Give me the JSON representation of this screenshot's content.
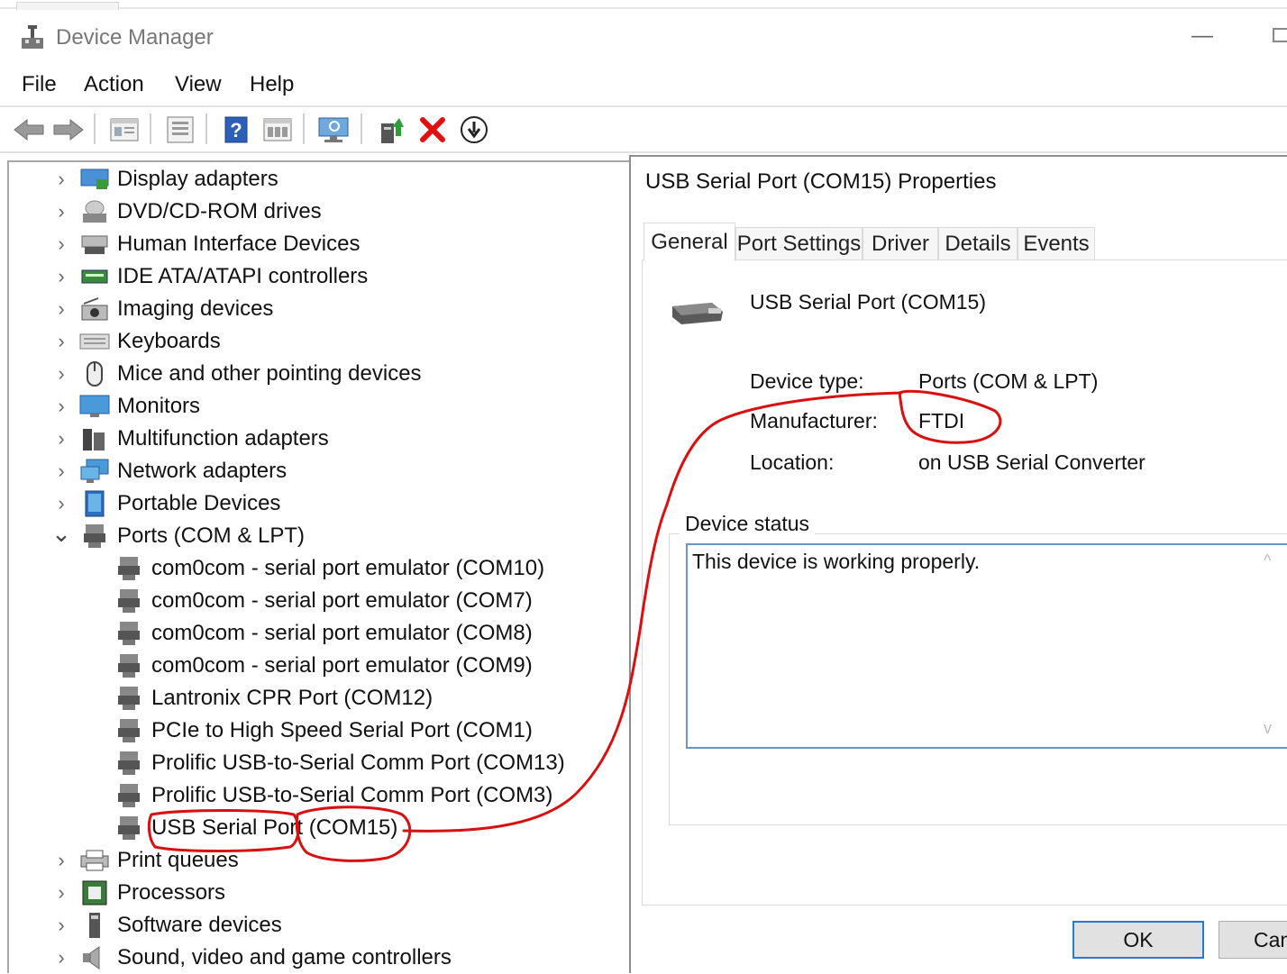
{
  "window": {
    "title": "Device Manager"
  },
  "menu": [
    "File",
    "Action",
    "View",
    "Help"
  ],
  "toolbar": [
    "back-icon",
    "forward-icon",
    "properties-view-icon",
    "device-view-icon",
    "help-icon",
    "resource-view-icon",
    "scan-hardware-icon",
    "update-driver-icon",
    "uninstall-icon",
    "disable-device-icon"
  ],
  "tree": {
    "categories_top": [
      {
        "label": "Display adapters",
        "icon": "display-adapter-icon"
      },
      {
        "label": "DVD/CD-ROM drives",
        "icon": "dvd-drive-icon"
      },
      {
        "label": "Human Interface Devices",
        "icon": "hid-icon"
      },
      {
        "label": "IDE ATA/ATAPI controllers",
        "icon": "ide-controller-icon"
      },
      {
        "label": "Imaging devices",
        "icon": "camera-icon"
      },
      {
        "label": "Keyboards",
        "icon": "keyboard-icon"
      },
      {
        "label": "Mice and other pointing devices",
        "icon": "mouse-icon"
      },
      {
        "label": "Monitors",
        "icon": "monitor-icon"
      },
      {
        "label": "Multifunction adapters",
        "icon": "multifunction-icon"
      },
      {
        "label": "Network adapters",
        "icon": "network-adapter-icon"
      },
      {
        "label": "Portable Devices",
        "icon": "portable-device-icon"
      }
    ],
    "ports": {
      "label": "Ports (COM & LPT)",
      "children": [
        "com0com - serial port emulator (COM10)",
        "com0com - serial port emulator (COM7)",
        "com0com - serial port emulator (COM8)",
        "com0com - serial port emulator (COM9)",
        "Lantronix CPR Port (COM12)",
        "PCIe to High Speed Serial Port (COM1)",
        "Prolific USB-to-Serial Comm Port (COM13)",
        "Prolific USB-to-Serial Comm Port (COM3)",
        "USB Serial Port (COM15)"
      ]
    },
    "categories_bottom": [
      {
        "label": "Print queues",
        "icon": "printer-icon"
      },
      {
        "label": "Processors",
        "icon": "processor-icon"
      },
      {
        "label": "Software devices",
        "icon": "software-device-icon"
      },
      {
        "label": "Sound, video and game controllers",
        "icon": "speaker-icon"
      }
    ]
  },
  "dialog": {
    "title": "USB Serial Port (COM15) Properties",
    "tabs": [
      "General",
      "Port Settings",
      "Driver",
      "Details",
      "Events"
    ],
    "device_name": "USB Serial Port (COM15)",
    "device_type_label": "Device type:",
    "device_type_value": "Ports (COM & LPT)",
    "manufacturer_label": "Manufacturer:",
    "manufacturer_value": "FTDI",
    "location_label": "Location:",
    "location_value": "on USB Serial Converter",
    "status_legend": "Device status",
    "status_text": "This device is working properly.",
    "ok_label": "OK",
    "cancel_label": "Can"
  },
  "colors": {
    "annotation": "#d81010",
    "focus_border": "#2b78d0",
    "status_border": "#6a96c5"
  }
}
